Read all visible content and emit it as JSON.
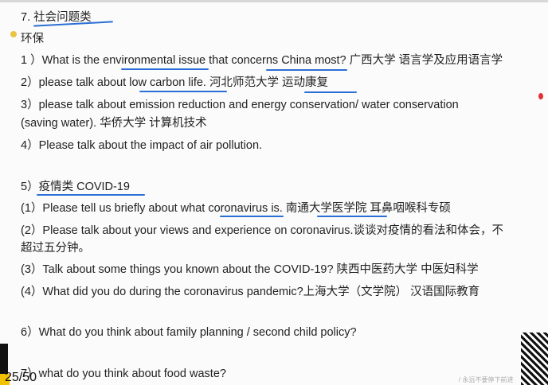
{
  "section_title": "7. 社会问题类",
  "subtitle": "环保",
  "lines": [
    "1 ）What is the environmental issue that concerns China most?  广西大学  语言学及应用语言学",
    "2）please talk about low carbon life. 河北师范大学  运动康复",
    "3）please talk about emission reduction and energy conservation/ water  conservation",
    "(saving water).    华侨大学   计算机技术",
    "4）Please talk about the impact of air pollution.",
    "5）疫情类 COVID-19",
    "(1）Please tell us briefly about what coronavirus is. 南通大学医学院 耳鼻咽喉科专硕",
    "(2）Please talk about your views and experience on coronavirus.谈谈对疫情的看法和体会，不",
    "超过五分钟。",
    "(3）Talk about  some things  you known about the COVID-19? 陕西中医药大学   中医妇科学",
    "(4）What did you do during the coronavirus pandemic?上海大学（文学院）  汉语国际教育",
    "6）What do you think about family planning / second child policy?",
    "7）what do you think about food waste?"
  ],
  "page_indicator": "25/50",
  "watermark": "/ 永远不要停下前进",
  "colors": {
    "underline": "#2a6fd6",
    "dot_yellow": "#e8c440",
    "dot_red": "#e53030"
  }
}
